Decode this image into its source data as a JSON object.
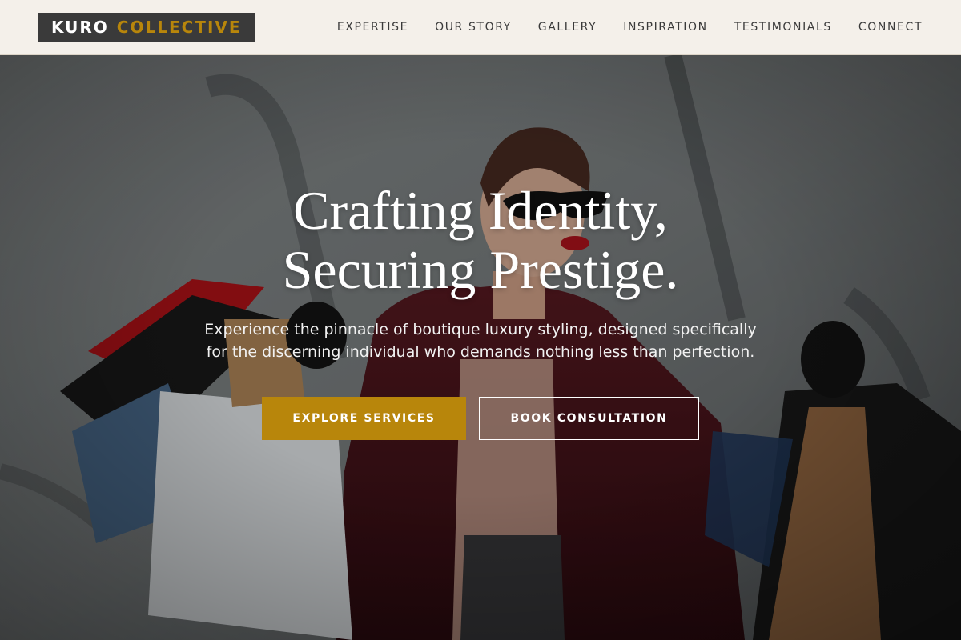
{
  "brand": {
    "word1": "KURO",
    "word2": "COLLECTIVE"
  },
  "nav": {
    "items": [
      {
        "label": "EXPERTISE"
      },
      {
        "label": "OUR STORY"
      },
      {
        "label": "GALLERY"
      },
      {
        "label": "INSPIRATION"
      },
      {
        "label": "TESTIMONIALS"
      },
      {
        "label": "CONNECT"
      }
    ]
  },
  "hero": {
    "headline_line1": "Crafting Identity,",
    "headline_line2": "Securing Prestige.",
    "subtitle": "Experience the pinnacle of boutique luxury styling, designed specifically for the discerning individual who demands nothing less than perfection.",
    "primary_button": "EXPLORE SERVICES",
    "secondary_button": "BOOK CONSULTATION"
  },
  "colors": {
    "header_bg": "#f4f0ea",
    "logo_bg": "#3a3a3a",
    "accent_gold": "#b8860b",
    "nav_text": "#3a3a3a"
  }
}
